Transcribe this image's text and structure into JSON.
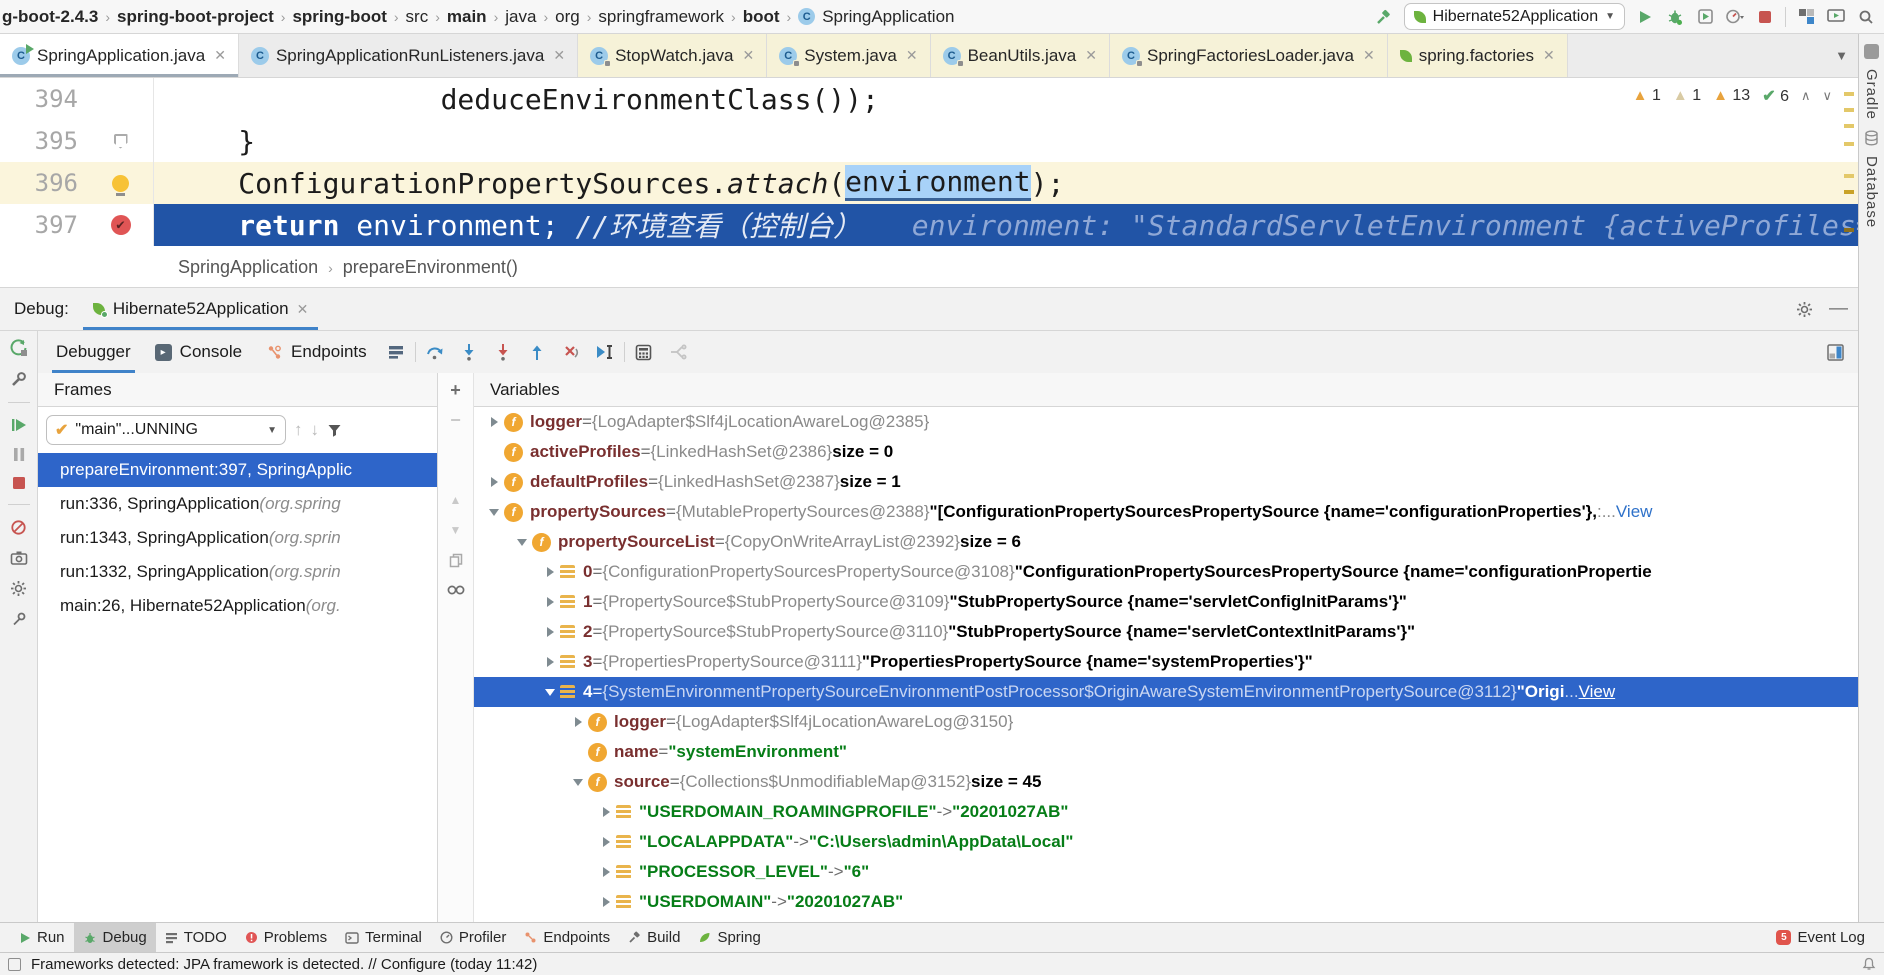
{
  "top_bar": {
    "breadcrumbs": [
      {
        "label": "g-boot-2.4.3",
        "bold": true
      },
      {
        "label": "spring-boot-project",
        "bold": true
      },
      {
        "label": "spring-boot",
        "bold": true
      },
      {
        "label": "src",
        "bold": false
      },
      {
        "label": "main",
        "bold": true
      },
      {
        "label": "java",
        "bold": false
      },
      {
        "label": "org",
        "bold": false
      },
      {
        "label": "springframework",
        "bold": false
      },
      {
        "label": "boot",
        "bold": true
      },
      {
        "label": "SpringApplication",
        "bold": false,
        "icon": "class"
      }
    ],
    "run_config": "Hibernate52Application"
  },
  "editor_tabs": [
    {
      "label": "SpringApplication.java",
      "icon": "class-run",
      "state": "active"
    },
    {
      "label": "SpringApplicationRunListeners.java",
      "icon": "class",
      "state": "normal"
    },
    {
      "label": "StopWatch.java",
      "icon": "class-lock",
      "state": "library"
    },
    {
      "label": "System.java",
      "icon": "class-lock",
      "state": "library"
    },
    {
      "label": "BeanUtils.java",
      "icon": "class-lock",
      "state": "library"
    },
    {
      "label": "SpringFactoriesLoader.java",
      "icon": "class-lock",
      "state": "library"
    },
    {
      "label": "spring.factories",
      "icon": "spring",
      "state": "library"
    }
  ],
  "editor": {
    "lines": [
      {
        "num": "394",
        "gutter": null,
        "bg": "white",
        "segs": [
          [
            "code",
            "                 deduceEnvironmentClass());"
          ]
        ]
      },
      {
        "num": "395",
        "gutter": "fold",
        "bg": "white",
        "segs": [
          [
            "code",
            "     }"
          ]
        ]
      },
      {
        "num": "396",
        "gutter": "bulb",
        "bg": "cream",
        "segs": [
          [
            "code",
            "     ConfigurationPropertySources."
          ],
          [
            "italic",
            "attach"
          ],
          [
            "code",
            "("
          ],
          [
            "sel",
            "environment"
          ],
          [
            "code",
            ");"
          ]
        ]
      },
      {
        "num": "397",
        "gutter": "breakpoint",
        "bg": "exec",
        "segs": [
          [
            "code",
            "     "
          ],
          [
            "kw",
            "return"
          ],
          [
            "code",
            " environment; "
          ],
          [
            "comment",
            "//环境查看（控制台）"
          ],
          [
            "hint",
            "   environment: \"StandardServletEnvironment {activeProfiles=["
          ]
        ]
      }
    ],
    "inspections": {
      "warn_a": "1",
      "warn_b": "1",
      "warn_c": "13",
      "passed": "6"
    }
  },
  "nav_bar": {
    "class_name": "SpringApplication",
    "method": "prepareEnvironment()"
  },
  "debug": {
    "label": "Debug:",
    "session": "Hibernate52Application",
    "tabs": {
      "debugger": "Debugger",
      "console": "Console",
      "endpoints": "Endpoints"
    },
    "frames": {
      "header": "Frames",
      "thread": "\"main\"...UNNING",
      "rows": [
        {
          "text": "prepareEnvironment:397, SpringApplic",
          "pkg": "",
          "selected": true
        },
        {
          "text": "run:336, SpringApplication ",
          "pkg": "(org.spring",
          "selected": false
        },
        {
          "text": "run:1343, SpringApplication ",
          "pkg": "(org.sprin",
          "selected": false
        },
        {
          "text": "run:1332, SpringApplication ",
          "pkg": "(org.sprin",
          "selected": false
        },
        {
          "text": "main:26, Hibernate52Application ",
          "pkg": "(org.",
          "selected": false
        }
      ]
    },
    "variables": {
      "header": "Variables",
      "rows": [
        {
          "indent": 0,
          "chev": "c",
          "icon": "f",
          "selected": false,
          "spans": [
            [
              "name",
              "logger"
            ],
            [
              "p",
              " = "
            ],
            [
              "type",
              "{LogAdapter$Slf4jLocationAwareLog@2385}"
            ]
          ]
        },
        {
          "indent": 0,
          "chev": null,
          "icon": "f",
          "selected": false,
          "spans": [
            [
              "name",
              "activeProfiles"
            ],
            [
              "p",
              " = "
            ],
            [
              "type",
              "{LinkedHashSet@2386}"
            ],
            [
              "b",
              "  size = 0"
            ]
          ]
        },
        {
          "indent": 0,
          "chev": "c",
          "icon": "f",
          "selected": false,
          "spans": [
            [
              "name",
              "defaultProfiles"
            ],
            [
              "p",
              " = "
            ],
            [
              "type",
              "{LinkedHashSet@2387}"
            ],
            [
              "b",
              "  size = 1"
            ]
          ]
        },
        {
          "indent": 0,
          "chev": "e",
          "icon": "f",
          "selected": false,
          "spans": [
            [
              "name",
              "propertySources"
            ],
            [
              "p",
              " = "
            ],
            [
              "type",
              "{MutablePropertySources@2388}"
            ],
            [
              "b",
              " \"[ConfigurationPropertySourcesPropertySource {name='configurationProperties'},"
            ],
            [
              "type",
              " :... "
            ],
            [
              "view",
              "View"
            ]
          ]
        },
        {
          "indent": 1,
          "chev": "e",
          "icon": "f",
          "selected": false,
          "spans": [
            [
              "name",
              "propertySourceList"
            ],
            [
              "p",
              " = "
            ],
            [
              "type",
              "{CopyOnWriteArrayList@2392}"
            ],
            [
              "b",
              "  size = 6"
            ]
          ]
        },
        {
          "indent": 2,
          "chev": "c",
          "icon": "i",
          "selected": false,
          "spans": [
            [
              "name",
              "0"
            ],
            [
              "p",
              " = "
            ],
            [
              "type",
              "{ConfigurationPropertySourcesPropertySource@3108}"
            ],
            [
              "b",
              " \"ConfigurationPropertySourcesPropertySource {name='configurationPropertie"
            ]
          ]
        },
        {
          "indent": 2,
          "chev": "c",
          "icon": "i",
          "selected": false,
          "spans": [
            [
              "name",
              "1"
            ],
            [
              "p",
              " = "
            ],
            [
              "type",
              "{PropertySource$StubPropertySource@3109}"
            ],
            [
              "b",
              " \"StubPropertySource {name='servletConfigInitParams'}\""
            ]
          ]
        },
        {
          "indent": 2,
          "chev": "c",
          "icon": "i",
          "selected": false,
          "spans": [
            [
              "name",
              "2"
            ],
            [
              "p",
              " = "
            ],
            [
              "type",
              "{PropertySource$StubPropertySource@3110}"
            ],
            [
              "b",
              " \"StubPropertySource {name='servletContextInitParams'}\""
            ]
          ]
        },
        {
          "indent": 2,
          "chev": "c",
          "icon": "i",
          "selected": false,
          "spans": [
            [
              "name",
              "3"
            ],
            [
              "p",
              " = "
            ],
            [
              "type",
              "{PropertiesPropertySource@3111}"
            ],
            [
              "b",
              " \"PropertiesPropertySource {name='systemProperties'}\""
            ]
          ]
        },
        {
          "indent": 2,
          "chev": "e",
          "icon": "i",
          "selected": true,
          "spans": [
            [
              "name",
              "4"
            ],
            [
              "p",
              " = "
            ],
            [
              "type",
              "{SystemEnvironmentPropertySourceEnvironmentPostProcessor$OriginAwareSystemEnvironmentPropertySource@3112}"
            ],
            [
              "b",
              " \"Origi"
            ],
            [
              "type",
              "... "
            ],
            [
              "view",
              "View"
            ]
          ]
        },
        {
          "indent": 3,
          "chev": "c",
          "icon": "f",
          "selected": false,
          "spans": [
            [
              "name",
              "logger"
            ],
            [
              "p",
              " = "
            ],
            [
              "type",
              "{LogAdapter$Slf4jLocationAwareLog@3150}"
            ]
          ]
        },
        {
          "indent": 3,
          "chev": null,
          "icon": "f",
          "selected": false,
          "spans": [
            [
              "name",
              "name"
            ],
            [
              "p",
              " = "
            ],
            [
              "g",
              "\"systemEnvironment\""
            ]
          ]
        },
        {
          "indent": 3,
          "chev": "e",
          "icon": "f",
          "selected": false,
          "spans": [
            [
              "name",
              "source"
            ],
            [
              "p",
              " = "
            ],
            [
              "type",
              "{Collections$UnmodifiableMap@3152}"
            ],
            [
              "b",
              "  size = 45"
            ]
          ]
        },
        {
          "indent": 4,
          "chev": "c",
          "icon": "i",
          "selected": false,
          "spans": [
            [
              "g",
              "\"USERDOMAIN_ROAMINGPROFILE\""
            ],
            [
              "p",
              " -> "
            ],
            [
              "g",
              "\"20201027AB\""
            ]
          ]
        },
        {
          "indent": 4,
          "chev": "c",
          "icon": "i",
          "selected": false,
          "spans": [
            [
              "g",
              "\"LOCALAPPDATA\""
            ],
            [
              "p",
              " -> "
            ],
            [
              "g",
              "\"C:\\Users\\admin\\AppData\\Local\""
            ]
          ]
        },
        {
          "indent": 4,
          "chev": "c",
          "icon": "i",
          "selected": false,
          "spans": [
            [
              "g",
              "\"PROCESSOR_LEVEL\""
            ],
            [
              "p",
              " -> "
            ],
            [
              "g",
              "\"6\""
            ]
          ]
        },
        {
          "indent": 4,
          "chev": "c",
          "icon": "i",
          "selected": false,
          "spans": [
            [
              "g",
              "\"USERDOMAIN\""
            ],
            [
              "p",
              " -> "
            ],
            [
              "g",
              "\"20201027AB\""
            ]
          ]
        }
      ]
    }
  },
  "right_strip": {
    "labels": [
      "Gradle",
      "Database"
    ]
  },
  "bottom_bar": {
    "left": [
      {
        "icon": "run",
        "label": "Run",
        "active": false
      },
      {
        "icon": "debug",
        "label": "Debug",
        "active": true
      },
      {
        "icon": "todo",
        "label": "TODO",
        "active": false
      },
      {
        "icon": "problems",
        "label": "Problems",
        "active": false
      },
      {
        "icon": "terminal",
        "label": "Terminal",
        "active": false
      },
      {
        "icon": "profiler",
        "label": "Profiler",
        "active": false
      },
      {
        "icon": "endpoints",
        "label": "Endpoints",
        "active": false
      },
      {
        "icon": "build",
        "label": "Build",
        "active": false
      },
      {
        "icon": "spring",
        "label": "Spring",
        "active": false
      }
    ],
    "right": [
      {
        "icon": "balloon",
        "badge": "5",
        "label": "Event Log"
      }
    ]
  },
  "status_bar": {
    "message": "Frameworks detected: JPA framework is detected. // Configure (today 11:42)"
  }
}
